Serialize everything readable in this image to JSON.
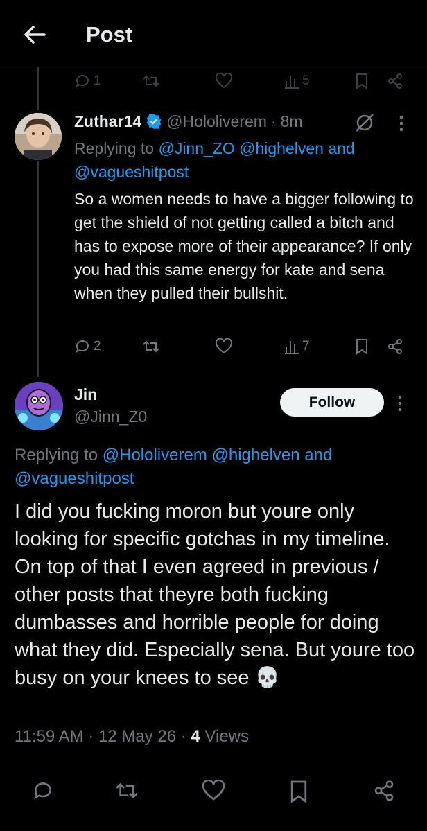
{
  "header": {
    "title": "Post"
  },
  "prev_tweet": {
    "stats": {
      "replies": "1",
      "views": "5"
    }
  },
  "reply": {
    "name": "Zuthar14",
    "handle": "@Hololiverem",
    "sep": "·",
    "time": "8m",
    "replying_prefix": "Replying to",
    "replying_mentions": "@Jinn_ZO @highelven and @vagueshitpost",
    "body": "So a women needs to have a bigger following to get the shield of not getting called a bitch and has to expose more of their appearance? If only you had this same energy for kate and sena when they pulled their bullshit.",
    "stats": {
      "replies": "2",
      "views": "7"
    }
  },
  "main": {
    "name": "Jin",
    "handle": "@Jinn_Z0",
    "follow_label": "Follow",
    "replying_prefix": "Replying to",
    "replying_mentions": "@Hololiverem @highelven and @vagueshitpost",
    "body": "I did you fucking moron but youre only looking for specific gotchas in my timeline. On top of that I even agreed in previous / other posts that theyre both fucking dumbasses and horrible people for doing  what they did. Especially sena. But youre too busy on your knees to see 💀",
    "time": "11:59 AM",
    "date": "12 May 26",
    "views_count": "4",
    "views_label": "Views",
    "sep": "·"
  },
  "colors": {
    "accent": "#1d9bf0",
    "background": "#000000",
    "text": "#e7e9ea",
    "muted": "#71767b"
  },
  "icons": [
    "back-arrow-icon",
    "reply-icon",
    "repost-icon",
    "like-icon",
    "views-icon",
    "bookmark-icon",
    "share-icon",
    "verified-icon",
    "grok-icon",
    "more-icon"
  ]
}
